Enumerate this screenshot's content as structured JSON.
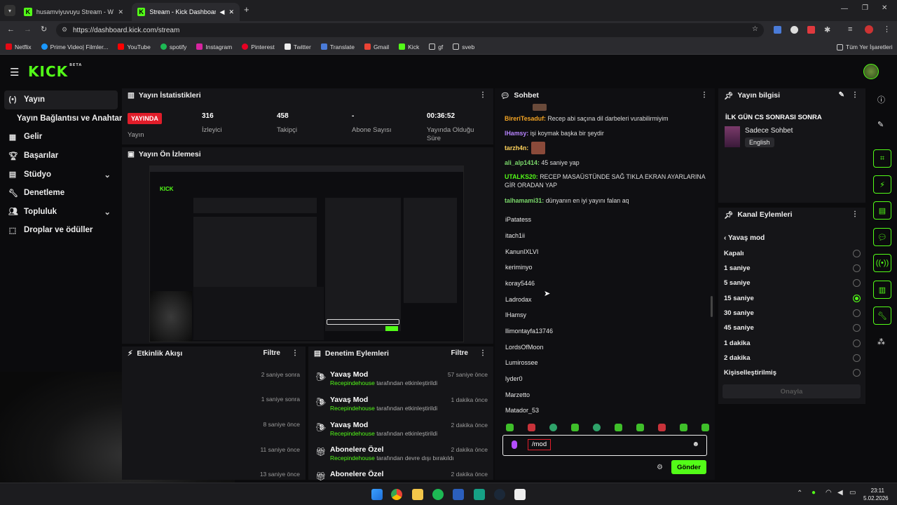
{
  "browser": {
    "tabs": [
      {
        "title": "husamviyuvuyu Stream - Watch",
        "active": false
      },
      {
        "title": "Stream - Kick Dashboard",
        "active": true
      }
    ],
    "url": "https://dashboard.kick.com/stream",
    "bookmarks": [
      "Netflix",
      "Prime Video| Filmler...",
      "YouTube",
      "spotify",
      "Instagram",
      "Pinterest",
      "Twitter",
      "Translate",
      "Gmail",
      "Kick",
      "gf",
      "sveb"
    ],
    "all_bookmarks": "Tüm Yer İşaretleri"
  },
  "brand": {
    "logo": "KICK",
    "beta": "BETA",
    "accent": "#53fc18"
  },
  "sidebar": {
    "items": [
      {
        "label": "Yayın",
        "selected": true
      },
      {
        "label": "Yayın Bağlantısı ve Anahtarı"
      },
      {
        "label": "Gelir"
      },
      {
        "label": "Başarılar"
      },
      {
        "label": "Stüdyo"
      },
      {
        "label": "Denetleme"
      },
      {
        "label": "Topluluk"
      },
      {
        "label": "Droplar ve ödüller"
      }
    ]
  },
  "stats": {
    "title": "Yayın İstatistikleri",
    "live_badge": "YAYINDA",
    "live_label": "Yayın",
    "viewers_value": "316",
    "viewers_label": "İzleyici",
    "followers_value": "458",
    "followers_label": "Takipçi",
    "subs_value": "-",
    "subs_label": "Abone Sayısı",
    "uptime_value": "00:36:52",
    "uptime_label": "Yayında Olduğu Süre"
  },
  "preview": {
    "title": "Yayın Ön İzlemesi"
  },
  "activity": {
    "title": "Etkinlik Akışı",
    "filter": "Filtre",
    "times": [
      "2 saniye sonra",
      "1 saniye sonra",
      "8 saniye önce",
      "11 saniye önce",
      "13 saniye önce"
    ]
  },
  "moderation": {
    "title": "Denetim Eylemleri",
    "filter": "Filtre",
    "actions": [
      {
        "title": "Yavaş Mod",
        "user": "Recepindehouse",
        "text": "tarafından etkinleştirildi",
        "time": "57 saniye önce"
      },
      {
        "title": "Yavaş Mod",
        "user": "Recepindehouse",
        "text": "tarafından etkinleştirildi",
        "time": "1 dakika önce"
      },
      {
        "title": "Yavaş Mod",
        "user": "Recepindehouse",
        "text": "tarafından etkinleştirildi",
        "time": "2 dakika önce"
      },
      {
        "title": "Abonelere Özel",
        "user": "Recepindehouse",
        "text": "tarafından devre dışı bırakıldı",
        "time": "2 dakika önce"
      },
      {
        "title": "Abonelere Özel",
        "user": "",
        "text": "",
        "time": "2 dakika önce"
      }
    ]
  },
  "chat": {
    "title": "Sohbet",
    "messages": [
      {
        "user": "BireriTesaduf:",
        "text": "Recep abi saçına dil darbeleri vurabilirmiyim",
        "color": "#f5a524"
      },
      {
        "user": "lHamsy:",
        "text": "işi koymak başka bir şeydir",
        "color": "#b784ff"
      },
      {
        "user": "tarzh4n:",
        "text": "",
        "color": "#ffd35c"
      },
      {
        "user": "ali_alp1414:",
        "text": "45 saniye yap",
        "color": "#7bd96b"
      },
      {
        "user": "UTALKS20:",
        "text": "RECEP MASAÜSTÜNDE SAĞ TIKLA EKRAN AYARLARINA GİR ORADAN YAP",
        "color": "#53fc18"
      },
      {
        "user": "talhamami31:",
        "text": "dünyanın en iyi yayını falan aq",
        "color": "#7bd96b"
      }
    ],
    "suggestions": [
      "iPatatess",
      "itach1ii",
      "KanunIXLVI",
      "keriminyo",
      "koray5446",
      "Ladrodax",
      "lHamsy",
      "llimontayfa13746",
      "LordsOfMoon",
      "Lumirossee",
      "lyder0",
      "Marzetto",
      "Matador_53"
    ],
    "input_value": "/mod",
    "send": "Gönder"
  },
  "stream_info": {
    "title": "Yayın bilgisi",
    "stream_title": "İLK GÜN CS SONRASI SONRA",
    "category": "Sadece Sohbet",
    "language": "English"
  },
  "channel_actions": {
    "title": "Kanal Eylemleri",
    "back_label": "Yavaş mod",
    "options": [
      "Kapalı",
      "1 saniye",
      "5 saniye",
      "15 saniye",
      "30 saniye",
      "45 saniye",
      "1 dakika",
      "2 dakika",
      "Kişiselleştirilmiş"
    ],
    "selected_index": 3,
    "confirm": "Onayla"
  },
  "taskbar": {
    "time": "23:11",
    "date": "5.02.2026"
  }
}
